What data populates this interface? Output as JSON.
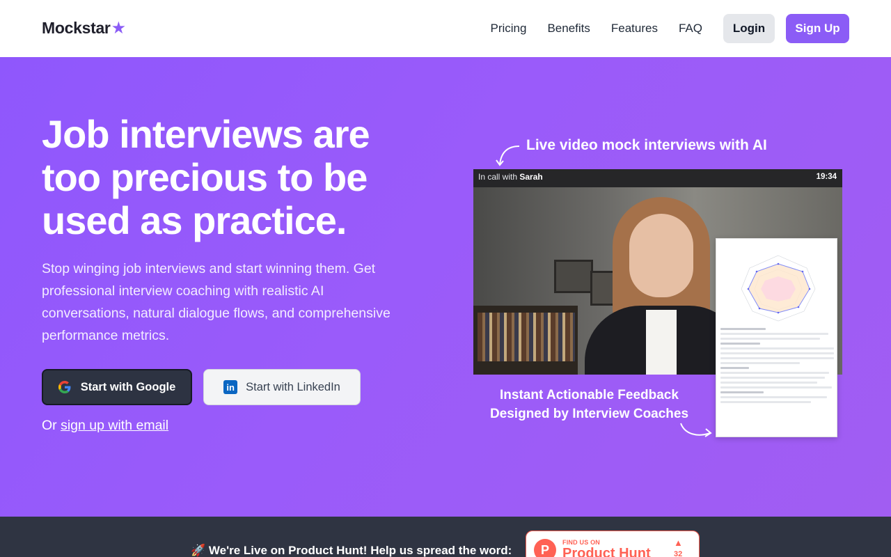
{
  "nav": {
    "logo_text": "Mockstar",
    "logo_star": "★",
    "links": [
      "Pricing",
      "Benefits",
      "Features",
      "FAQ"
    ],
    "login_label": "Login",
    "signup_label": "Sign Up"
  },
  "hero": {
    "title": "Job interviews are too precious to be used as practice.",
    "subtitle": "Stop winging job interviews and start winning them. Get professional interview coaching with realistic AI conversations, natural dialogue flows, and comprehensive performance metrics.",
    "google_button": "Start with Google",
    "linkedin_button": "Start with LinkedIn",
    "or_prefix": "Or",
    "email_link": "sign up with email"
  },
  "showcase": {
    "callout_top": "Live video mock interviews with AI",
    "call_prefix": "In call with",
    "call_name": "Sarah",
    "call_time": "19:34",
    "callout_bottom": "Instant Actionable Feedback Designed by Interview Coaches"
  },
  "strip": {
    "text": "🚀 We're Live on Product Hunt! Help us spread the word:",
    "badge_find": "FIND US ON",
    "badge_name": "Product Hunt",
    "badge_count": "32"
  },
  "colors": {
    "accent": "#8b5cf6",
    "hero_bg": "#9a5bfa",
    "strip_bg": "#2f3442",
    "product_hunt": "#ff6154"
  }
}
